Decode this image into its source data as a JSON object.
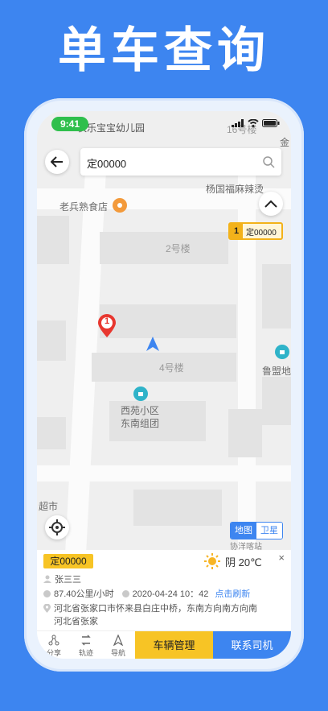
{
  "hero": {
    "title": "单车查询"
  },
  "status": {
    "time": "9:41"
  },
  "search": {
    "value": "定00000"
  },
  "map": {
    "labels": {
      "kindergarten": "快乐宝宝幼儿园",
      "building16": "16号楼",
      "jin": "金",
      "restaurant1": "杨国福麻辣烫",
      "restaurant2": "老兵熟食店",
      "bldg2": "2号楼",
      "bldg4": "4号楼",
      "xiyuan": "西苑小区\n东南组团",
      "lumeng": "鲁盟地",
      "supermarket": "超市",
      "bottomright": "协洋喀站"
    },
    "marker": {
      "number": "1",
      "plate": "定00000"
    },
    "pin_number": "1",
    "maptype": {
      "map": "地图",
      "satellite": "卫星"
    }
  },
  "panel": {
    "plate": "定00000",
    "weather": "阴 20℃",
    "close": "×",
    "driver": "张三三",
    "speed": "87.40公里/小时",
    "datetime": "2020-04-24 10：42",
    "refresh": "点击刷新",
    "address_line1": "河北省张家口市怀来县白庄中桥，东南方向南方向南",
    "address_line2": "河北省张家"
  },
  "bottom": {
    "share": "分享",
    "track": "轨迹",
    "navigate": "导航",
    "manage": "车辆管理",
    "contact": "联系司机"
  },
  "colors": {
    "brand_blue": "#3d85f0",
    "accent_yellow": "#f7c425",
    "status_green": "#2fbf4c",
    "pin_red": "#e8372f"
  }
}
